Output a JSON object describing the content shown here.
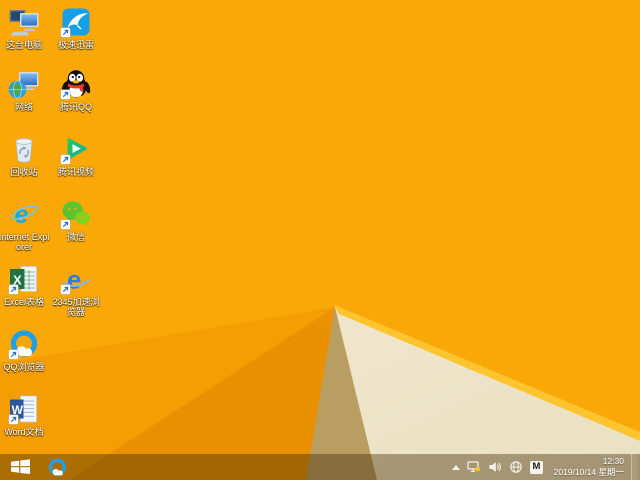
{
  "colors": {
    "wp-base": "#F9A808",
    "wp-facet-a": "#F49E03",
    "wp-facet-b": "#EE9603",
    "wp-tan": "#B89E63",
    "wp-cream": "#F5EFDC",
    "wp-cream-deep": "#EAE0C2",
    "wp-edge": "#FFC42E",
    "taskbar-tint": "rgba(70,45,8,0.42)",
    "icon-label": "#FFFFFF",
    "thunder-blue": "#169FE6",
    "ie-blue": "#1CA7E0",
    "excel-green": "#217346",
    "word-blue": "#2B579A",
    "qqb-blue": "#1E9FE8",
    "b2345-blue": "#2F7BD9",
    "wechat-green": "#5BC430",
    "video-green-1": "#2BC553",
    "video-green-2": "#0FB3A6",
    "qq-red": "#E23B30"
  },
  "desktop": {
    "icons": [
      {
        "id": "this-pc",
        "label": "这台电脑",
        "shortcut": false
      },
      {
        "id": "thunder-speed",
        "label": "极速迅雷",
        "shortcut": true
      },
      {
        "id": "network",
        "label": "网络",
        "shortcut": false
      },
      {
        "id": "tencent-qq",
        "label": "腾讯QQ",
        "shortcut": true
      },
      {
        "id": "recycle-bin",
        "label": "回收站",
        "shortcut": false
      },
      {
        "id": "tencent-video",
        "label": "腾讯视频",
        "shortcut": true
      },
      {
        "id": "internet-explorer",
        "label": "Internet Explorer",
        "shortcut": false,
        "glyph": "e"
      },
      {
        "id": "wechat",
        "label": "微信",
        "shortcut": true
      },
      {
        "id": "excel-sheet",
        "label": "Excel表格",
        "shortcut": true,
        "glyph": "X"
      },
      {
        "id": "2345-browser",
        "label": "2345加速浏览器",
        "shortcut": true,
        "glyph": "e"
      },
      {
        "id": "qq-browser",
        "label": "QQ浏览器",
        "shortcut": true
      },
      {
        "id": "word-doc",
        "label": "Word文档",
        "shortcut": true,
        "glyph": "W"
      }
    ]
  },
  "taskbar": {
    "start": {
      "icon": "windows-logo"
    },
    "pinned": [
      {
        "id": "qq-browser-task",
        "icon": "qq-browser"
      }
    ],
    "tray": {
      "icons": [
        "hidden-icons-chevron",
        "pc-security",
        "volume",
        "network-globe",
        "input-method"
      ],
      "input_method_label": "M",
      "time": "12:30",
      "date": "2019/10/14 星期一"
    }
  }
}
